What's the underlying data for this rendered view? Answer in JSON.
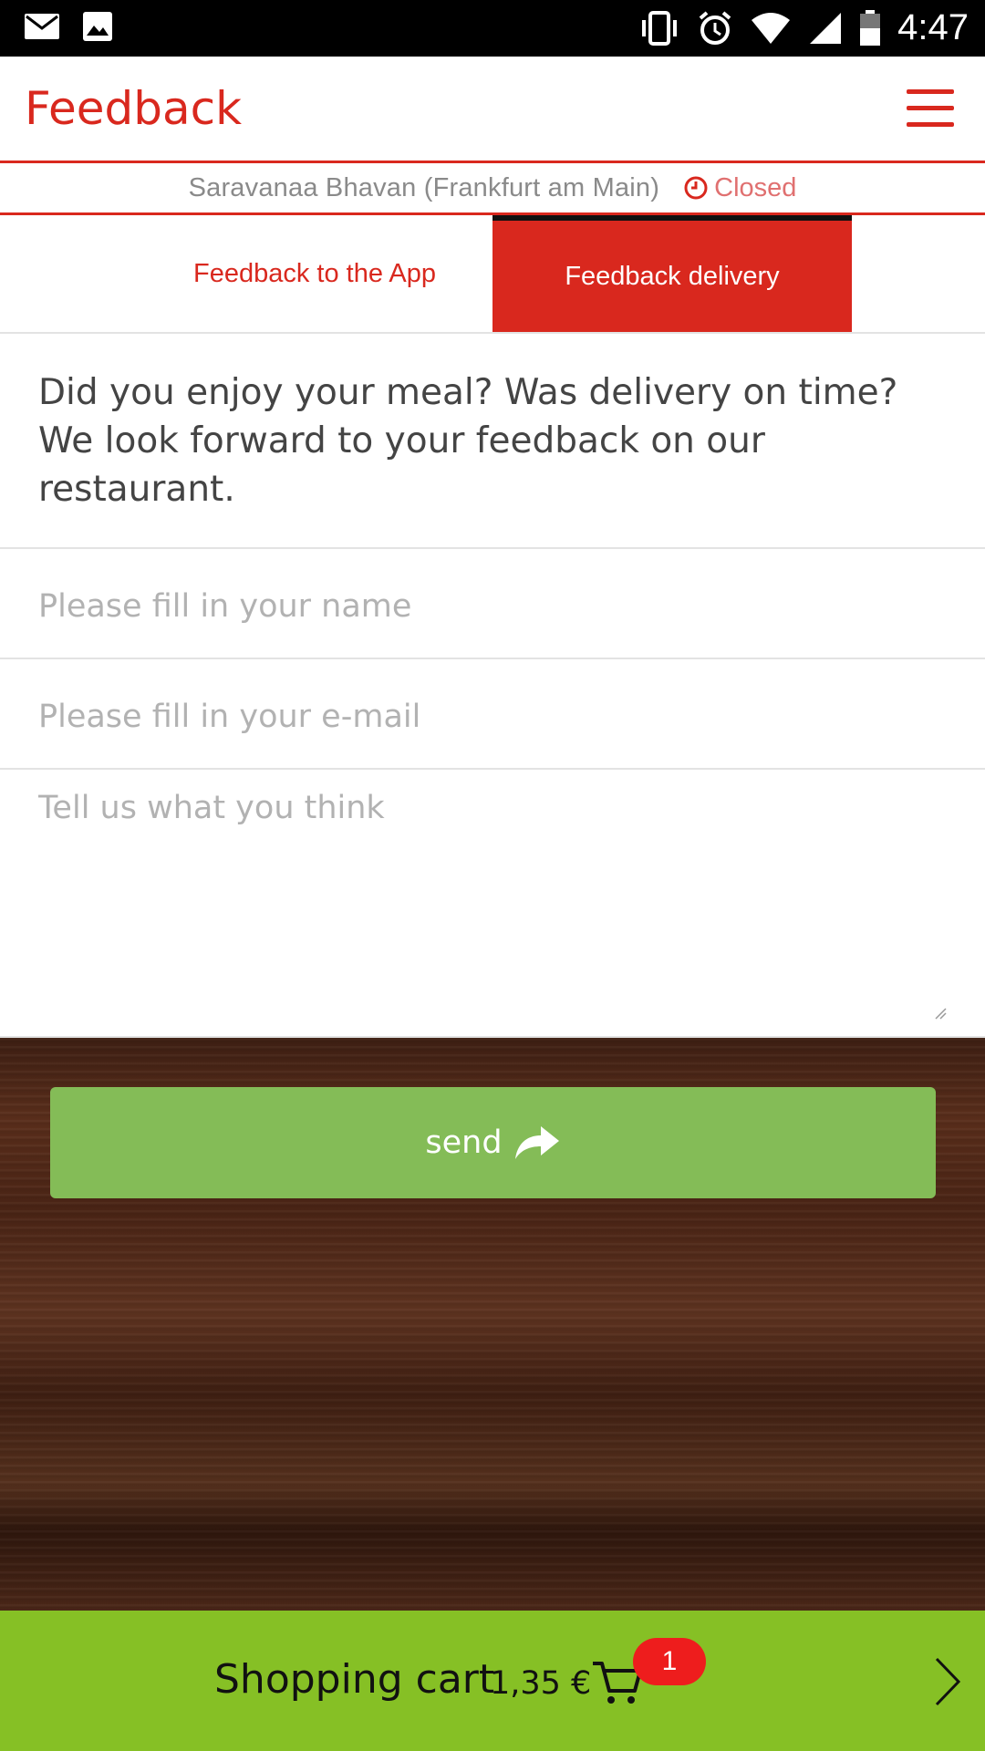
{
  "status_bar": {
    "time": "4:47",
    "icons": [
      "mail-icon",
      "image-icon",
      "vibrate-icon",
      "alarm-icon",
      "wifi-icon",
      "signal-icon",
      "battery-icon"
    ]
  },
  "header": {
    "title": "Feedback",
    "menu_icon": "hamburger-menu-icon",
    "accent_color": "#d9281e"
  },
  "restaurant": {
    "name": "Saravanaa Bhavan (Frankfurt am Main)",
    "status": "Closed",
    "status_icon": "clock-icon"
  },
  "tabs": [
    {
      "label": "Feedback to the App",
      "active": false
    },
    {
      "label": "Feedback delivery",
      "active": true
    }
  ],
  "intro_text": "Did you enjoy your meal? Was delivery on time? We look forward to your feedback on our restaurant.",
  "form": {
    "name_placeholder": "Please fill in your name",
    "email_placeholder": "Please fill in your e-mail",
    "message_placeholder": "Tell us what you think",
    "send_label": "send",
    "send_icon": "share-arrow-icon",
    "send_color": "#84bc57"
  },
  "cart": {
    "label": "Shopping cart",
    "price": "1,35 €",
    "count": "1",
    "cart_icon": "shopping-cart-icon",
    "arrow_icon": "chevron-right-icon",
    "bar_color": "#86c025"
  }
}
